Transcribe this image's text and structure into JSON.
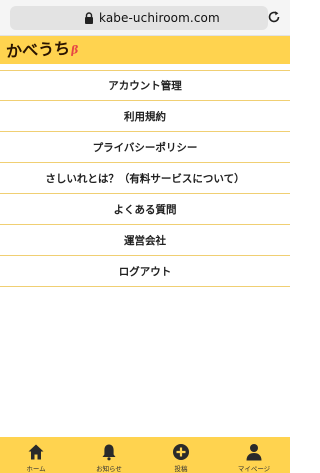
{
  "browser": {
    "url": "kabe-uchiroom.com",
    "lock_icon": "lock-icon",
    "reload_icon": "reload-icon"
  },
  "header": {
    "logo_text": "かべうち",
    "logo_suffix": "β",
    "background": "#ffd34f"
  },
  "menu": {
    "items": [
      {
        "label": "アカウント管理"
      },
      {
        "label": "利用規約"
      },
      {
        "label": "プライバシーポリシー"
      },
      {
        "label": "さしいれとは？（有料サービスについて）"
      },
      {
        "label": "よくある質問"
      },
      {
        "label": "運営会社"
      },
      {
        "label": "ログアウト"
      }
    ],
    "divider_color": "#f0cf73"
  },
  "tab_bar": {
    "items": [
      {
        "label": "ホーム",
        "icon": "home-icon"
      },
      {
        "label": "お知らせ",
        "icon": "bell-icon"
      },
      {
        "label": "投稿",
        "icon": "plus-circle-icon"
      },
      {
        "label": "マイページ",
        "icon": "person-icon"
      }
    ]
  }
}
